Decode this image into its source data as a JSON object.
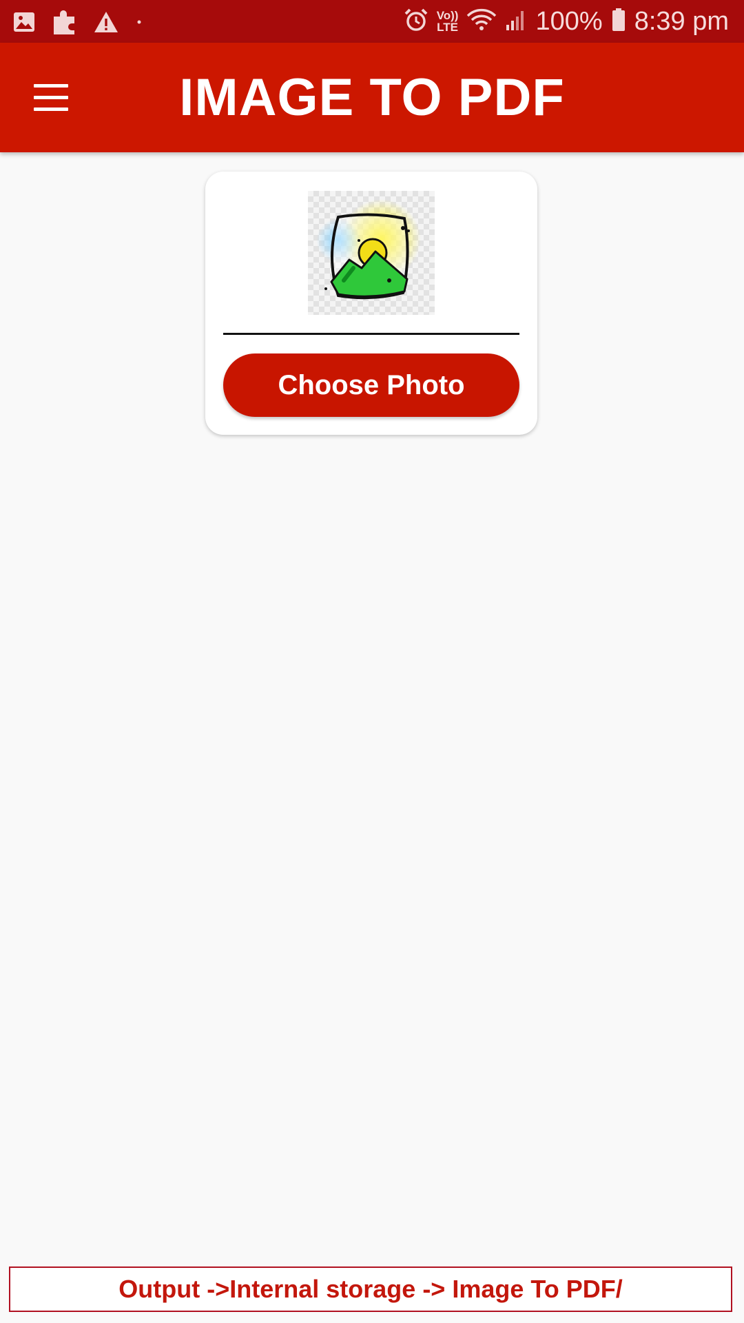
{
  "status_bar": {
    "icons_left": [
      "image-icon",
      "puzzle-icon",
      "warning-icon",
      "dot-icon"
    ],
    "icons_right": [
      "alarm-icon",
      "volte-icon",
      "wifi-icon",
      "signal-icon",
      "battery-icon"
    ],
    "volte_top": "Vo))",
    "volte_bottom": "LTE",
    "battery": "100%",
    "time": "8:39 pm"
  },
  "app_bar": {
    "title": "IMAGE TO PDF",
    "menu_icon": "hamburger-menu-icon",
    "color": "#cc1700"
  },
  "card": {
    "placeholder_icon": "landscape-image-icon",
    "button_label": "Choose Photo",
    "button_color": "#c81500"
  },
  "footer": {
    "text": "Output ->Internal storage -> Image To PDF/",
    "text_color": "#c3170c"
  }
}
